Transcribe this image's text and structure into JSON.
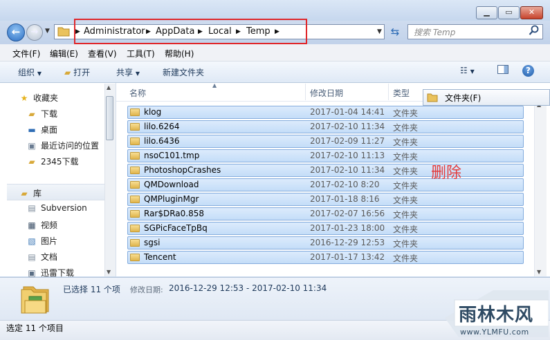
{
  "address": {
    "crumbs": [
      "Administrator",
      "AppData",
      "Local",
      "Temp"
    ]
  },
  "search": {
    "placeholder": "搜索 Temp"
  },
  "menu": [
    "文件(F)",
    "编辑(E)",
    "查看(V)",
    "工具(T)",
    "帮助(H)"
  ],
  "toolbar": {
    "organize": "组织",
    "open": "打开",
    "share": "共享",
    "new_folder": "新建文件夹"
  },
  "nav": {
    "favorites_header": "收藏夹",
    "favorites": [
      "下载",
      "桌面",
      "最近访问的位置",
      "2345下载"
    ],
    "libraries_header": "库",
    "libraries": [
      "Subversion",
      "视频",
      "图片",
      "文档",
      "迅雷下载"
    ]
  },
  "columns": {
    "name": "名称",
    "date": "修改日期",
    "type": "类型"
  },
  "files": [
    {
      "name": "klog",
      "date": "2017-01-04 14:41",
      "type": "文件夹"
    },
    {
      "name": "lilo.6264",
      "date": "2017-02-10 11:34",
      "type": "文件夹"
    },
    {
      "name": "lilo.6436",
      "date": "2017-02-09 11:27",
      "type": "文件夹"
    },
    {
      "name": "nsoC101.tmp",
      "date": "2017-02-10 11:13",
      "type": "文件夹"
    },
    {
      "name": "PhotoshopCrashes",
      "date": "2017-02-10 11:34",
      "type": "文件夹"
    },
    {
      "name": "QMDownload",
      "date": "2017-02-10 8:20",
      "type": "文件夹"
    },
    {
      "name": "QMPluginMgr",
      "date": "2017-01-18 8:16",
      "type": "文件夹"
    },
    {
      "name": "Rar$DRa0.858",
      "date": "2017-02-07 16:56",
      "type": "文件夹"
    },
    {
      "name": "SGPicFaceTpBq",
      "date": "2017-01-23 18:00",
      "type": "文件夹"
    },
    {
      "name": "sgsi",
      "date": "2016-12-29 12:53",
      "type": "文件夹"
    },
    {
      "name": "Tencent",
      "date": "2017-01-17 13:42",
      "type": "文件夹"
    }
  ],
  "tooltip": "文件夹(F)",
  "annotation": "删除",
  "details": {
    "selected": "已选择 11 个项",
    "modified_label": "修改日期:",
    "modified_range": "2016-12-29 12:53 - 2017-02-10 11:34"
  },
  "status": "选定 11 个项目",
  "watermark": {
    "brand": "雨林木风",
    "url": "www.YLMFU.com"
  },
  "colors": {
    "selection": "#cce1f8",
    "selection_border": "#84acdd",
    "highlight_box": "#e0262a",
    "annotation": "#e43a3a"
  }
}
